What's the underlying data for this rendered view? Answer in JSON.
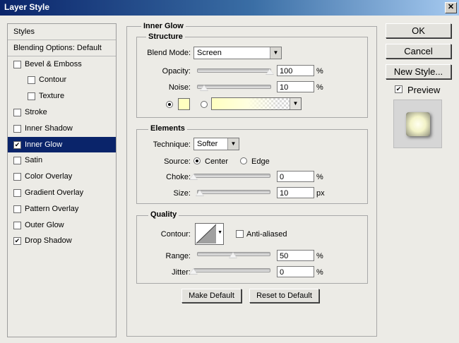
{
  "window": {
    "title": "Layer Style",
    "close_glyph": "✕"
  },
  "left_panel": {
    "items": [
      {
        "label": "Styles",
        "checkbox": false,
        "checked": false,
        "selected": false
      },
      {
        "label": "Blending Options: Default",
        "checkbox": false,
        "checked": false,
        "selected": false
      },
      {
        "label": "Bevel & Emboss",
        "checkbox": true,
        "checked": false,
        "selected": false
      },
      {
        "label": "Contour",
        "checkbox": true,
        "checked": false,
        "selected": false
      },
      {
        "label": "Texture",
        "checkbox": true,
        "checked": false,
        "selected": false
      },
      {
        "label": "Stroke",
        "checkbox": true,
        "checked": false,
        "selected": false
      },
      {
        "label": "Inner Shadow",
        "checkbox": true,
        "checked": false,
        "selected": false
      },
      {
        "label": "Inner Glow",
        "checkbox": true,
        "checked": true,
        "selected": true
      },
      {
        "label": "Satin",
        "checkbox": true,
        "checked": false,
        "selected": false
      },
      {
        "label": "Color Overlay",
        "checkbox": true,
        "checked": false,
        "selected": false
      },
      {
        "label": "Gradient Overlay",
        "checkbox": true,
        "checked": false,
        "selected": false
      },
      {
        "label": "Pattern Overlay",
        "checkbox": true,
        "checked": false,
        "selected": false
      },
      {
        "label": "Outer Glow",
        "checkbox": true,
        "checked": false,
        "selected": false
      },
      {
        "label": "Drop Shadow",
        "checkbox": true,
        "checked": true,
        "selected": false
      }
    ]
  },
  "inner_glow": {
    "title": "Inner Glow",
    "structure": {
      "title": "Structure",
      "blend_mode_label": "Blend Mode:",
      "blend_mode_value": "Screen",
      "opacity_label": "Opacity:",
      "opacity_value": "100",
      "opacity_level": 1.0,
      "noise_label": "Noise:",
      "noise_value": "10",
      "noise_level": 0.1,
      "percent": "%",
      "glow_color": "#ffffc0"
    },
    "elements": {
      "title": "Elements",
      "technique_label": "Technique:",
      "technique_value": "Softer",
      "source_label": "Source:",
      "source_center": "Center",
      "source_edge": "Edge",
      "choke_label": "Choke:",
      "choke_value": "0",
      "choke_level": 0.0,
      "size_label": "Size:",
      "size_value": "10",
      "size_level": 0.04,
      "percent": "%",
      "px": "px"
    },
    "quality": {
      "title": "Quality",
      "contour_label": "Contour:",
      "anti_aliased_label": "Anti-aliased",
      "range_label": "Range:",
      "range_value": "50",
      "range_level": 0.5,
      "jitter_label": "Jitter:",
      "jitter_value": "0",
      "jitter_level": 0.0,
      "percent": "%"
    },
    "make_default": "Make Default",
    "reset_default": "Reset to Default"
  },
  "right": {
    "ok": "OK",
    "cancel": "Cancel",
    "new_style": "New Style...",
    "preview_label": "Preview",
    "preview_checked": true
  },
  "colors": {
    "selection": "#0a246a",
    "title_start": "#0a246a",
    "title_end": "#a6caf0"
  }
}
